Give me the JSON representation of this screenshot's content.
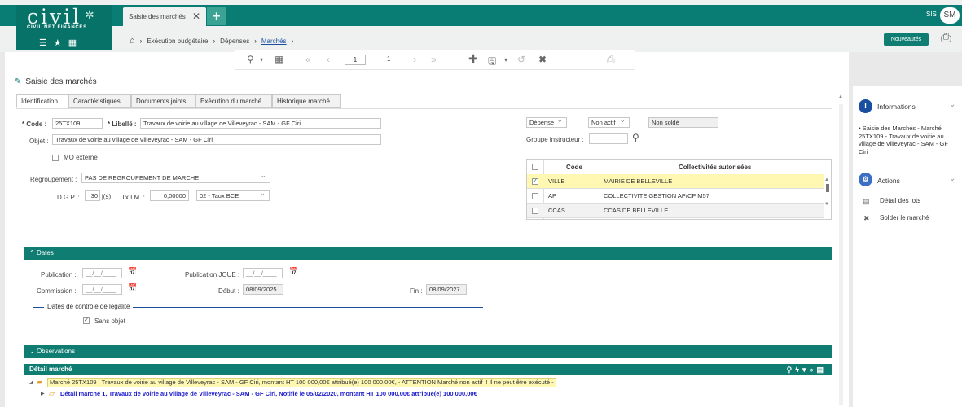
{
  "app": {
    "logo_text": "civil",
    "logo_sub": "CIVIL NET FINANCES",
    "tab_title": "Saisie des marchés",
    "user_initials_label": "SIS",
    "avatar": "SM",
    "new_button": "Nouveautés"
  },
  "breadcrumb": {
    "items": [
      "Exécution budgétaire",
      "Dépenses",
      "Marchés"
    ]
  },
  "toolbar": {
    "page": "1",
    "total": "1"
  },
  "page": {
    "title": "Saisie des marchés"
  },
  "tabs": [
    "Identification",
    "Caractéristiques",
    "Documents joints",
    "Exécution du marché",
    "Historique marché"
  ],
  "form": {
    "code_label": "* Code :",
    "code": "25TX109",
    "libelle_label": "* Libellé :",
    "libelle": "Travaux de voirie au village de Villeveyrac - SAM - GF Ciri",
    "objet_label": "Objet :",
    "objet": "Travaux de voirie au village de Villeveyrac - SAM - GF Ciri",
    "mo_externe": "MO externe",
    "regroupement_label": "Regroupement :",
    "regroupement": "PAS DE REGROUPEMENT DE MARCHE",
    "dgp_label": "D.G.P. :",
    "dgp": "30",
    "dgp_unit": "j(s)",
    "tx_label": "Tx I.M. :",
    "tx": "0,00000",
    "taux": "02 - Taux BCE",
    "depense": "Dépense",
    "non_actif": "Non actif",
    "non_solde": "Non soldé",
    "groupe_label": "Groupe instructeur :"
  },
  "grid": {
    "headers": [
      "Code",
      "Collectivités autorisées"
    ],
    "rows": [
      {
        "code": "VILLE",
        "name": "MAIRIE DE BELLEVILLE",
        "checked": true
      },
      {
        "code": "AP",
        "name": "COLLECTIVITE GESTION AP/CP M57",
        "checked": false
      },
      {
        "code": "CCAS",
        "name": "CCAS DE BELLEVILLE",
        "checked": false
      }
    ]
  },
  "dates": {
    "section": "Dates",
    "publication": "Publication :",
    "publication_joue": "Publication JOUE :",
    "commission": "Commission :",
    "debut_label": "Début :",
    "debut": "08/09/2025",
    "fin_label": "Fin :",
    "fin": "08/09/2027",
    "empty_date": "__/__/____",
    "legal": "Dates de contrôle de légalité",
    "sans_objet": "Sans objet"
  },
  "observations": {
    "section": "Observations"
  },
  "detail": {
    "title": "Détail marché",
    "line1": "Marché 25TX109 , Travaux de voirie au village de Villeveyrac - SAM - GF Ciri,  montant HT 100 000,00€ attribué(e) 100 000,00€, - ATTENTION Marché non actif !! Il ne peut être exécuté -",
    "line2": "Détail marché 1, Travaux de voirie au village de Villeveyrac - SAM - GF Ciri, Notifié le 05/02/2020, montant HT 100 000,00€ attribué(e) 100 000,00€"
  },
  "sidebar": {
    "info_title": "Informations",
    "info_text": "• Saisie des Marchés - Marché 25TX109 - Travaux de voirie au village de Villeveyrac - SAM - GF Ciri",
    "actions_title": "Actions",
    "actions": [
      "Détail des lots",
      "Solder le marché"
    ]
  },
  "colors": {
    "teal": "#097d73",
    "highlight": "#fff8b3"
  }
}
